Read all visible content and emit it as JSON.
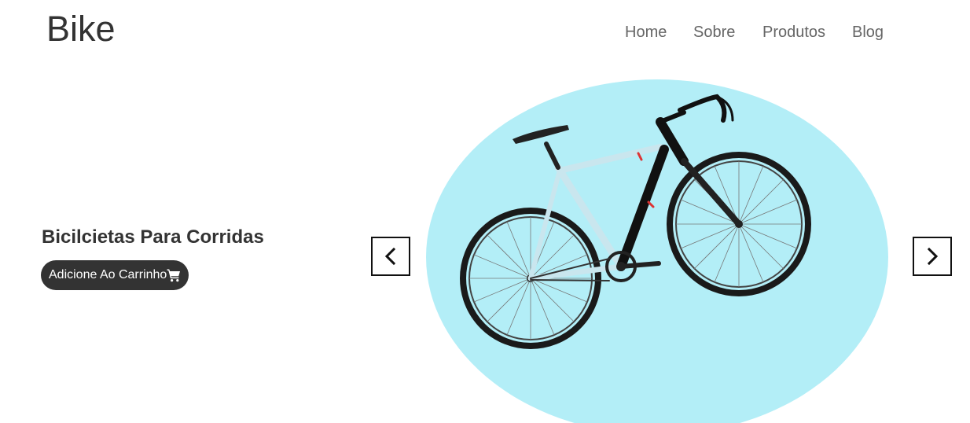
{
  "header": {
    "logo": "Bike",
    "nav": [
      "Home",
      "Sobre",
      "Produtos",
      "Blog"
    ]
  },
  "hero": {
    "title": "Bicilcietas Para Corridas",
    "cart_button_label": "Adicione Ao Carrinho",
    "cart_icon": "shopping-cart-icon",
    "prev_icon": "chevron-left-icon",
    "next_icon": "chevron-right-icon",
    "image_subject": "bicycle"
  },
  "colors": {
    "text_dark": "#333333",
    "nav_text": "#666666",
    "circle_bg": "#b3eef7",
    "button_bg": "#333333",
    "button_text": "#ffffff"
  }
}
